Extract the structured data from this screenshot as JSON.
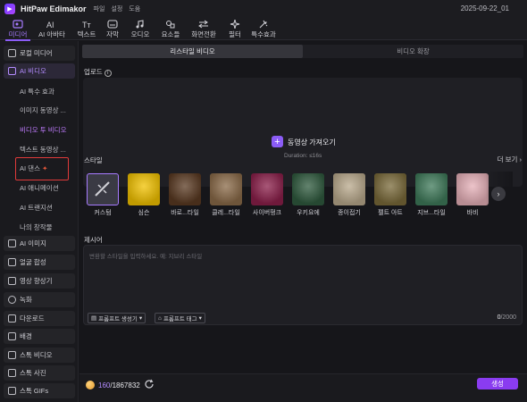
{
  "app": {
    "title": "HitPaw Edimakor",
    "menu": [
      "파일",
      "설정",
      "도움"
    ],
    "date": "2025-09-22_01"
  },
  "toolbar": [
    {
      "label": "미디어",
      "icon": "media-icon",
      "active": true
    },
    {
      "label": "AI 아바타",
      "icon": "ai-avatar-icon",
      "active": false
    },
    {
      "label": "텍스트",
      "icon": "text-icon",
      "active": false
    },
    {
      "label": "자막",
      "icon": "subtitle-icon",
      "active": false
    },
    {
      "label": "오디오",
      "icon": "audio-icon",
      "active": false
    },
    {
      "label": "요소들",
      "icon": "elements-icon",
      "active": false
    },
    {
      "label": "화면전환",
      "icon": "transition-icon",
      "active": false
    },
    {
      "label": "필터",
      "icon": "filter-icon",
      "active": false
    },
    {
      "label": "특수효과",
      "icon": "effects-icon",
      "active": false
    }
  ],
  "sidebar": {
    "items": [
      {
        "label": "로컬 미디어"
      },
      {
        "label": "AI 비디오"
      },
      {
        "label": "AI 이미지"
      },
      {
        "label": "얼굴 합성"
      },
      {
        "label": "영상 향상기"
      },
      {
        "label": "녹화"
      },
      {
        "label": "다운로드"
      },
      {
        "label": "배경"
      },
      {
        "label": "스톡 비디오"
      },
      {
        "label": "스톡 사진"
      },
      {
        "label": "스톡 GIFs"
      }
    ],
    "ai_video_sub": [
      {
        "label": "AI 특수 효과"
      },
      {
        "label": "이미지 동영상 ..."
      },
      {
        "label": "비디오 투 비디오"
      },
      {
        "label": "텍스트 동영상 ..."
      },
      {
        "label": "AI 댄스"
      },
      {
        "label": "AI 애니메이션"
      },
      {
        "label": "AI 트랜지션"
      },
      {
        "label": "나의 창작물"
      }
    ]
  },
  "main": {
    "tabs": [
      {
        "label": "리스타일 비디오"
      },
      {
        "label": "비디오 확장"
      }
    ],
    "upload": {
      "label": "업로드",
      "button": "동영상 가져오기",
      "duration": "Duration: ≤16s"
    },
    "style": {
      "label": "스타일",
      "more": "더 보기",
      "cards": [
        {
          "name": "커스텀",
          "color": "#3a3a44"
        },
        {
          "name": "심슨",
          "color": "#f2c200"
        },
        {
          "name": "바로...타일",
          "color": "#5a3a22"
        },
        {
          "name": "클레...타일",
          "color": "#8a6a48"
        },
        {
          "name": "사이버펑크",
          "color": "#8b1f4a"
        },
        {
          "name": "우키요에",
          "color": "#2f5a3e"
        },
        {
          "name": "종이접기",
          "color": "#b9a98c"
        },
        {
          "name": "펠트 아트",
          "color": "#7a6a3a"
        },
        {
          "name": "지브...타일",
          "color": "#3f7a5a"
        },
        {
          "name": "바비",
          "color": "#e6b0b8"
        }
      ]
    },
    "prompt": {
      "label": "제시어",
      "placeholder": "변환할 스타일을 입력하세요. 예: 지브리 스타일",
      "generator_chip": "프롬프트 생성기",
      "tag_chip": "프롬프트 태그",
      "count": "0",
      "max": "/2000"
    }
  },
  "footer": {
    "credits_used": "160",
    "credits_total": "/1867832",
    "generate": "생성"
  },
  "colors": {
    "accent": "#8b5cf6",
    "selection_outline": "#e03a3a"
  }
}
